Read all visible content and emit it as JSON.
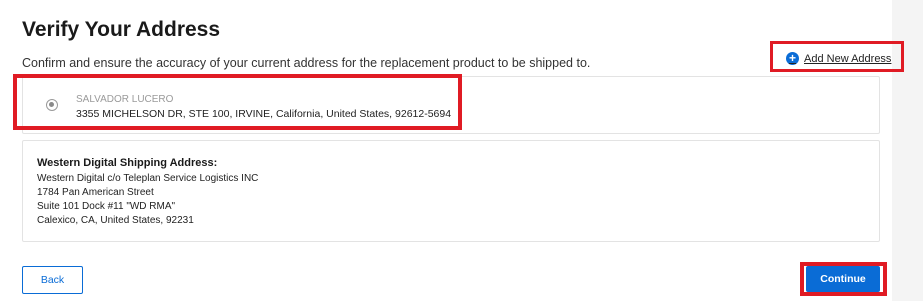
{
  "header": {
    "title": "Verify Your Address",
    "subtitle": "Confirm and ensure the accuracy of your current address for the replacement product to be shipped to."
  },
  "actions": {
    "add_new_address": "Add New Address",
    "back": "Back",
    "continue": "Continue"
  },
  "address": {
    "name": "SALVADOR LUCERO",
    "line": "3355 MICHELSON DR, STE 100, IRVINE, California, United States, 92612-5694",
    "selected": true
  },
  "wd_shipping": {
    "heading": "Western Digital Shipping Address:",
    "lines": [
      "Western Digital c/o Teleplan Service Logistics INC",
      "1784 Pan American Street",
      "Suite 101 Dock #11 \"WD RMA\"",
      "Calexico, CA, United States, 92231"
    ]
  },
  "colors": {
    "accent": "#0a6cd6",
    "highlight": "#e01b24"
  },
  "icons": {
    "add": "plus-circle-icon",
    "radio": "radio-selected-icon"
  }
}
